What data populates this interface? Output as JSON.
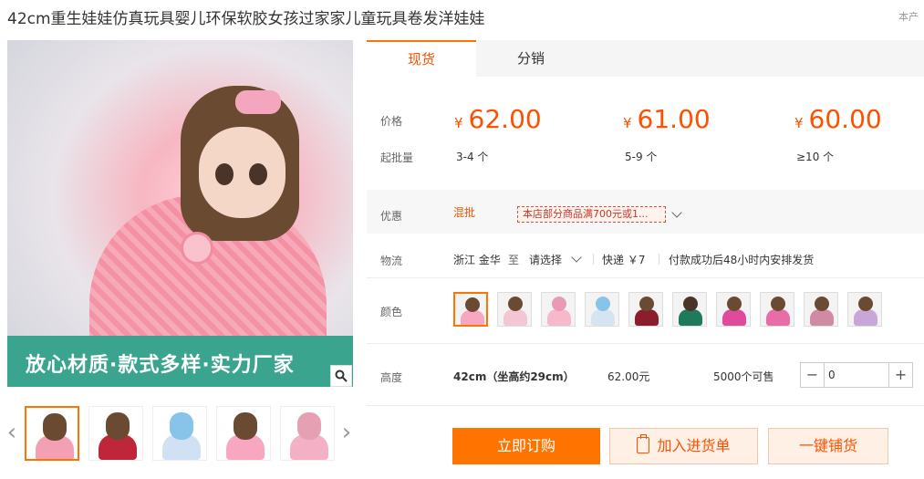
{
  "header": {
    "title": "42cm重生娃娃仿真玩具婴儿环保软胶女孩过家家儿童玩具卷发洋娃娃",
    "corner": "本产"
  },
  "gallery": {
    "banner_text": "放心材质·款式多样·实力厂家",
    "thumbnails": [
      {
        "hair": "#6b4a32",
        "dress": "#f4a0b4"
      },
      {
        "hair": "#6b4a32",
        "dress": "#c0263a"
      },
      {
        "hair": "#88c3ea",
        "dress": "#cfe1f3"
      },
      {
        "hair": "#6b4a32",
        "dress": "#f7a8c0"
      },
      {
        "hair": "#e6a0b4",
        "dress": "#f4b0c4"
      }
    ]
  },
  "tabs": [
    {
      "label": "现货",
      "active": true
    },
    {
      "label": "分销",
      "active": false
    }
  ],
  "pricing": {
    "price_label": "价格",
    "moq_label": "起批量",
    "currency": "¥",
    "tiers": [
      {
        "price": "62.00",
        "moq": "3-4 个"
      },
      {
        "price": "61.00",
        "moq": "5-9 个"
      },
      {
        "price": "60.00",
        "moq": "≥10 个"
      }
    ]
  },
  "promotion": {
    "label": "优惠",
    "tag": "混批",
    "coupon": "本店部分商品满700元或1..."
  },
  "logistics": {
    "label": "物流",
    "origin": "浙江 金华",
    "to": "至",
    "destination": "请选择",
    "express": "快递 ￥7",
    "note": "付款成功后48小时内安排发货"
  },
  "color": {
    "label": "颜色",
    "swatches": [
      {
        "hair": "#6b4a32",
        "dress": "#f7a8c0",
        "selected": true
      },
      {
        "hair": "#6b4a32",
        "dress": "#f2c6d2"
      },
      {
        "hair": "#e89ab6",
        "dress": "#f7b8cc"
      },
      {
        "hair": "#88c3ea",
        "dress": "#d6e4f2"
      },
      {
        "hair": "#6b4a32",
        "dress": "#8b1d2c"
      },
      {
        "hair": "#4a3328",
        "dress": "#1f7a5c"
      },
      {
        "hair": "#6b4a32",
        "dress": "#e04a9c"
      },
      {
        "hair": "#6b4a32",
        "dress": "#e86ca8"
      },
      {
        "hair": "#6b4a32",
        "dress": "#d18aa4"
      },
      {
        "hair": "#6b4a32",
        "dress": "#c9a6d8"
      }
    ]
  },
  "spec": {
    "label": "高度",
    "name": "42cm（坐高约29cm）",
    "price": "62.00元",
    "stock": "5000个可售"
  },
  "quantity": {
    "value": "0",
    "minus": "−",
    "plus": "+"
  },
  "actions": {
    "order": "立即订购",
    "add_list": "加入进货单",
    "one_click": "一键铺货"
  },
  "colors": {
    "accent": "#ff7300",
    "price": "#ff5000"
  }
}
